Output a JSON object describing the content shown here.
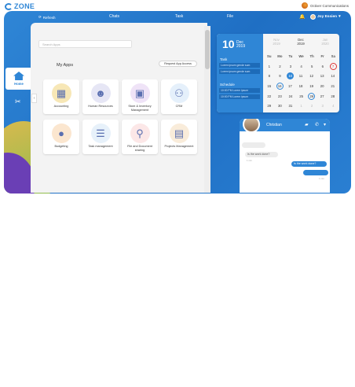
{
  "brand": {
    "logo": "ZONE",
    "company": "Octiver Communications"
  },
  "nav": {
    "refresh": "Refresh",
    "tabs": [
      "Chats",
      "Task",
      "File"
    ],
    "user": "Joy Essien",
    "bell_count": "1"
  },
  "sidebar": {
    "home": "Home"
  },
  "search": {
    "placeholder": "Search Apps"
  },
  "apps_section": {
    "title": "My Apps",
    "request_button": "Request App Access"
  },
  "apps": [
    {
      "name": "Accounting",
      "icon": "accounting-icon",
      "color": "#f7e7b6"
    },
    {
      "name": "Human Resources",
      "icon": "hr-icon",
      "color": "#e6e6f5"
    },
    {
      "name": "Store & Inventory Management",
      "icon": "inventory-icon",
      "color": "#efe3f7"
    },
    {
      "name": "CRM",
      "icon": "crm-icon",
      "color": "#e5f0fb"
    },
    {
      "name": "Budgeting",
      "icon": "budget-icon",
      "color": "#fbe6cf"
    },
    {
      "name": "Task management",
      "icon": "task-icon",
      "color": "#e7f1fa"
    },
    {
      "name": "File and Document sharing",
      "icon": "file-icon",
      "color": "#fce7e7"
    },
    {
      "name": "Projects Management",
      "icon": "project-icon",
      "color": "#f9ecda"
    }
  ],
  "calendar": {
    "day": "10",
    "month": "Dec",
    "year": "2019",
    "task_label": "Task",
    "task_items": [
      "Lorem ipsum gende sum",
      "Lorem ipsum gende sum"
    ],
    "schedule_label": "Schedule",
    "schedule_items": [
      "10:00 PM Lorem ipsum",
      "10:00 PM Lorem ipsum"
    ],
    "months": [
      {
        "name": "Nov",
        "year": "2019",
        "dim": true
      },
      {
        "name": "Dec",
        "year": "2019",
        "dim": false
      },
      {
        "name": "Jan",
        "year": "2020",
        "dim": true
      }
    ],
    "weekdays": [
      "Su",
      "Mo",
      "Tu",
      "We",
      "Th",
      "Fr",
      "Sa"
    ],
    "weeks": [
      [
        "1",
        "2",
        "3",
        "4",
        "5",
        "6",
        "7"
      ],
      [
        "8",
        "9",
        "10",
        "11",
        "12",
        "13",
        "14"
      ],
      [
        "15",
        "16",
        "17",
        "18",
        "19",
        "20",
        "21"
      ],
      [
        "22",
        "23",
        "24",
        "25",
        "26",
        "27",
        "28"
      ],
      [
        "29",
        "30",
        "31",
        "1",
        "2",
        "3",
        "4"
      ]
    ],
    "today": "10",
    "marked_red": "7",
    "ringed": [
      "16",
      "26"
    ]
  },
  "chat": {
    "name": "Christian",
    "messages": [
      {
        "side": "in",
        "text": "",
        "time": ""
      },
      {
        "side": "in",
        "text": "Is the work done?",
        "time": "1 min"
      },
      {
        "side": "out",
        "text": "Is the work done?",
        "time": ""
      },
      {
        "side": "out",
        "text": "",
        "time": "1 min"
      }
    ]
  }
}
